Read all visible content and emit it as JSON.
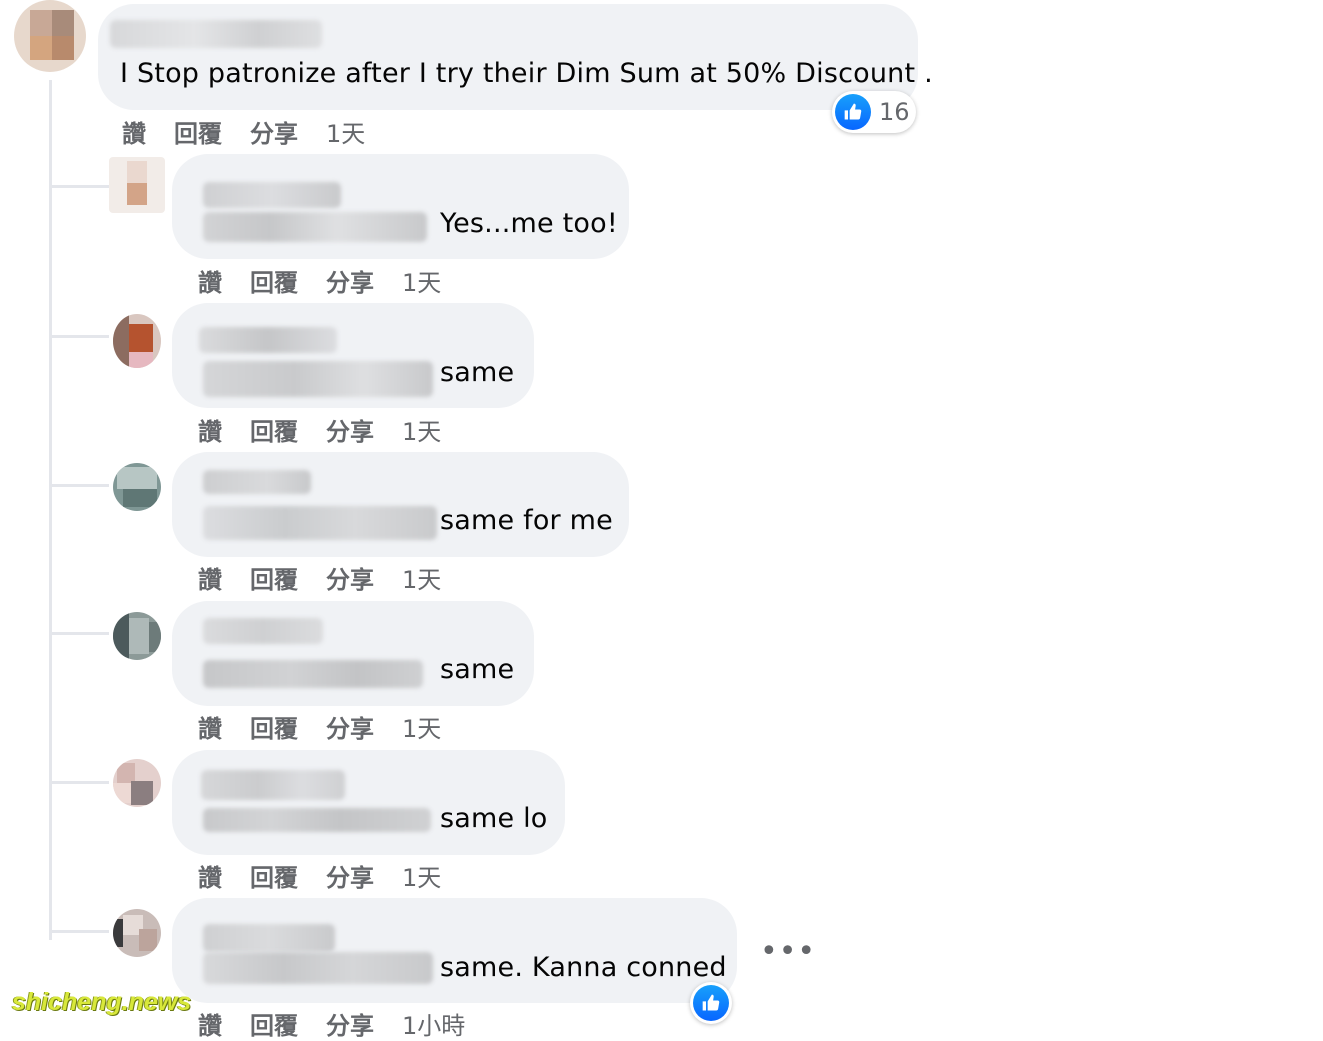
{
  "colors": {
    "bubble": "#f0f2f5",
    "like_blue": "#0866ff",
    "meta_text": "#65676b"
  },
  "main_comment": {
    "text": "I Stop patronize after I try their Dim Sum at 50% Discount .",
    "reaction_count": "16",
    "actions": {
      "like": "讚",
      "reply": "回覆",
      "share": "分享",
      "time": "1天"
    }
  },
  "replies": [
    {
      "text": "Yes...me too!",
      "actions": {
        "like": "讚",
        "reply": "回覆",
        "share": "分享",
        "time": "1天"
      }
    },
    {
      "text": "same",
      "actions": {
        "like": "讚",
        "reply": "回覆",
        "share": "分享",
        "time": "1天"
      }
    },
    {
      "text": "same for me",
      "actions": {
        "like": "讚",
        "reply": "回覆",
        "share": "分享",
        "time": "1天"
      }
    },
    {
      "text": "same",
      "actions": {
        "like": "讚",
        "reply": "回覆",
        "share": "分享",
        "time": "1天"
      }
    },
    {
      "text": "same lo",
      "actions": {
        "like": "讚",
        "reply": "回覆",
        "share": "分享",
        "time": "1天"
      }
    },
    {
      "text": "same. Kanna conned",
      "actions": {
        "like": "讚",
        "reply": "回覆",
        "share": "分享",
        "time": "1小時"
      }
    }
  ],
  "more_options": "•••",
  "watermark": "shicheng.news"
}
